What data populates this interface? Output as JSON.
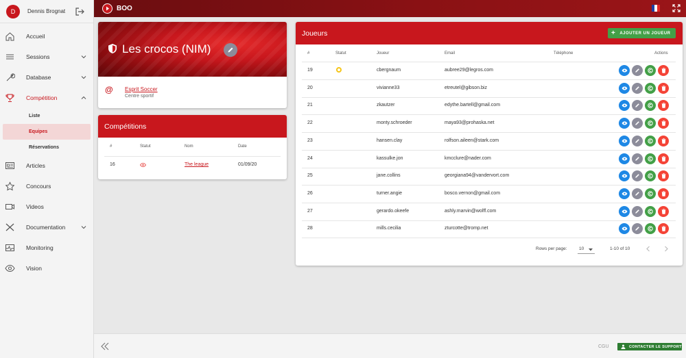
{
  "user": {
    "initial": "D",
    "name": "Dennis Brognat"
  },
  "app": {
    "brand": "BOO"
  },
  "sidebar": {
    "items": [
      {
        "label": "Accueil",
        "icon": "home-icon"
      },
      {
        "label": "Sessions",
        "icon": "menu-icon"
      },
      {
        "label": "Database",
        "icon": "wrench-icon"
      },
      {
        "label": "Compétition",
        "icon": "trophy-icon"
      },
      {
        "label": "Articles",
        "icon": "newspaper-icon"
      },
      {
        "label": "Concours",
        "icon": "star-icon"
      },
      {
        "label": "Videos",
        "icon": "video-icon"
      },
      {
        "label": "Documentation",
        "icon": "tools-icon"
      },
      {
        "label": "Monitoring",
        "icon": "monitor-icon"
      },
      {
        "label": "Vision",
        "icon": "eye-icon"
      }
    ],
    "sub": [
      "Liste",
      "Equipes",
      "Réservations"
    ]
  },
  "team": {
    "name": "Les crocos (NIM)",
    "club_symbol": "@",
    "club_name": "Esprit Soccer",
    "club_type": "Centre sportif"
  },
  "competitions": {
    "title": "Compétitions",
    "headers": [
      "#",
      "Statut",
      "Nom",
      "Date"
    ],
    "rows": [
      {
        "id": "16",
        "name": "The league",
        "date": "01/09/20"
      }
    ]
  },
  "players": {
    "title": "Joueurs",
    "add_label": "AJOUTER UN JOUEUR",
    "headers": [
      "#",
      "Statut",
      "Joueur",
      "Email",
      "Téléphone",
      "Actions"
    ],
    "rows": [
      {
        "id": "19",
        "player": "cbergnaum",
        "email": "aubree29@legros.com"
      },
      {
        "id": "20",
        "player": "vivianne33",
        "email": "etreutel@gibson.biz"
      },
      {
        "id": "21",
        "player": "zkautzer",
        "email": "edythe.bartell@gmail.com"
      },
      {
        "id": "22",
        "player": "monty.schroeder",
        "email": "maya93@prohaska.net"
      },
      {
        "id": "23",
        "player": "hansen.clay",
        "email": "rolfson.aileen@stark.com"
      },
      {
        "id": "24",
        "player": "kassulke.jon",
        "email": "kmcclure@nader.com"
      },
      {
        "id": "25",
        "player": "jane.collins",
        "email": "georgiana94@vandervort.com"
      },
      {
        "id": "26",
        "player": "turner.angie",
        "email": "bosco.vernon@gmail.com"
      },
      {
        "id": "27",
        "player": "gerardo.okeefe",
        "email": "ashly.marvin@wolff.com"
      },
      {
        "id": "28",
        "player": "mills.cecilia",
        "email": "zturcotte@tromp.net"
      }
    ],
    "pager": {
      "rows_per_page_label": "Rows per page:",
      "rows_per_page": "10",
      "range": "1-10 of 10"
    }
  },
  "footer": {
    "cgu": "CGU",
    "support": "CONTACTER LE SUPPORT"
  },
  "colors": {
    "accent": "#c8171d",
    "success": "#43a047",
    "info": "#1e88e5",
    "danger": "#f44336"
  }
}
